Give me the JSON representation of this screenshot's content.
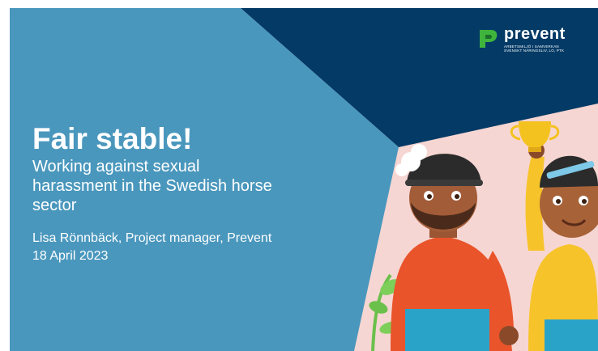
{
  "slide": {
    "title": "Fair stable!",
    "subtitle_lines": [
      "Working against sexual",
      "harassment in the Swedish horse",
      "sector"
    ],
    "presenter": "Lisa Rönnbäck, Project manager, Prevent",
    "date": "18 April 2023"
  },
  "logo": {
    "wordmark": "prevent",
    "tagline_lines": [
      "ARBETSMILJÖ I SAMVERKAN",
      "SVENSKT NÄRINGSLIV, LO, PTK"
    ]
  },
  "colors": {
    "main_panel": "#4a97bd",
    "corner_navy": "#033a66",
    "illustration_bg": "#f6d6d2",
    "logo_green": "#3eb43d"
  }
}
